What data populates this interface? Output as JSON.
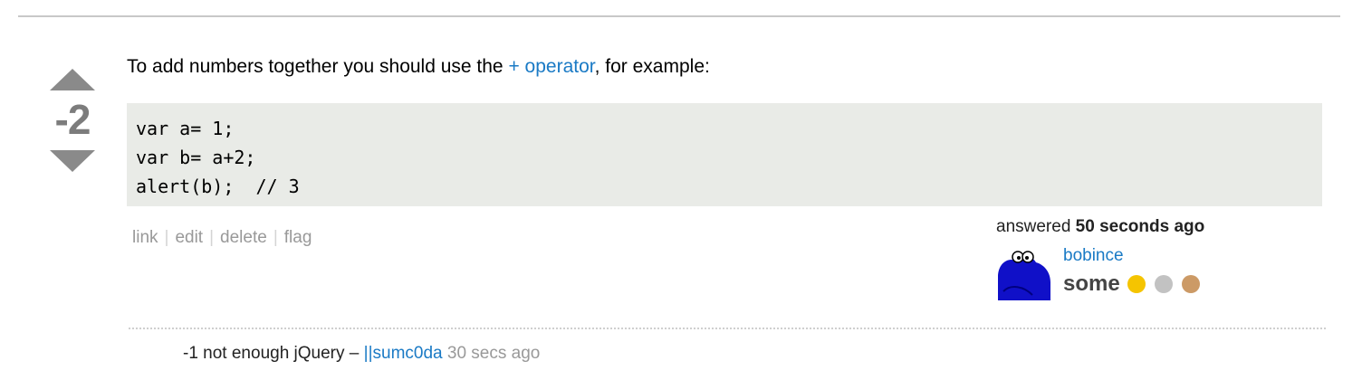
{
  "vote": {
    "score": "-2"
  },
  "post": {
    "intro_before": "To add numbers together you should use the ",
    "intro_link": "+ operator",
    "intro_after": ", for example:",
    "code": "var a= 1;\nvar b= a+2;\nalert(b);  // 3"
  },
  "menu": {
    "items": [
      "link",
      "edit",
      "delete",
      "flag"
    ]
  },
  "signature": {
    "action": "answered",
    "time": "50 seconds ago",
    "username": "bobince",
    "reputation": "some",
    "badges": [
      "#f5c400",
      "#c2c2c2",
      "#cc9a66"
    ]
  },
  "comment": {
    "text": "-1 not enough jQuery – ",
    "author": "||sumc0da",
    "time": "30 secs ago"
  }
}
